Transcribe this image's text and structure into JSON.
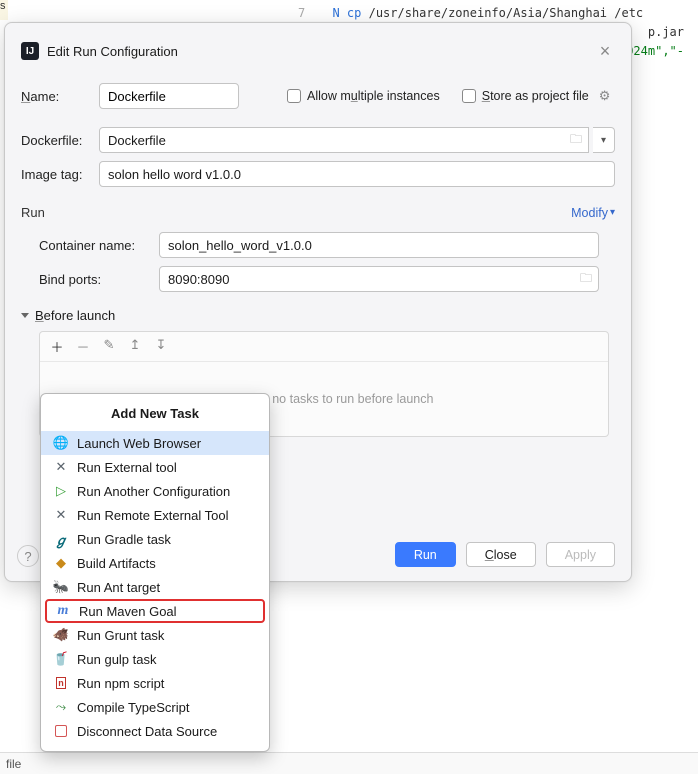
{
  "bg": {
    "line_num": "7",
    "code_kw": "N cp",
    "code_path": "/usr/share/zoneinfo/Asia/Shanghai /etc",
    "trail1": "p.jar",
    "trail2": "024m\",\"-"
  },
  "dialog": {
    "title": "Edit Run Configuration",
    "name_label": "Name:",
    "name_value": "Dockerfile",
    "allow_multiple": "Allow multiple instances",
    "store_as": "Store as project file",
    "dockerfile_label": "Dockerfile:",
    "dockerfile_value": "Dockerfile",
    "imagetag_label": "Image tag:",
    "imagetag_value": "solon hello word v1.0.0",
    "run_section": "Run",
    "modify": "Modify",
    "container_label": "Container name:",
    "container_value": "solon_hello_word_v1.0.0",
    "bindports_label": "Bind ports:",
    "bindports_value": "8090:8090",
    "before_launch": "Before launch",
    "empty_msg": "There are no tasks to run before launch",
    "run_btn": "Run",
    "close_btn": "Close",
    "apply_btn": "Apply"
  },
  "popup": {
    "title": "Add New Task",
    "items": [
      "Launch Web Browser",
      "Run External tool",
      "Run Another Configuration",
      "Run Remote External Tool",
      "Run Gradle task",
      "Build Artifacts",
      "Run Ant target",
      "Run Maven Goal",
      "Run Grunt task",
      "Run gulp task",
      "Run npm script",
      "Compile TypeScript",
      "Disconnect Data Source"
    ]
  },
  "bottom_tab": "file"
}
